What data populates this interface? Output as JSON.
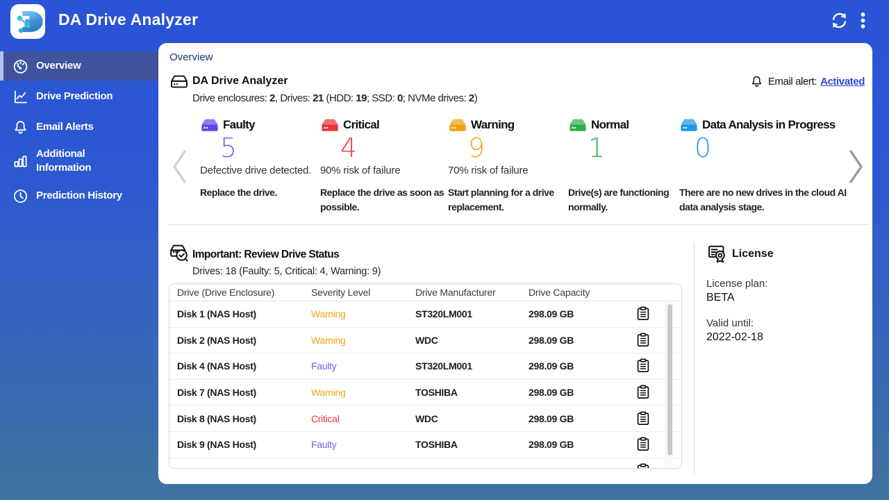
{
  "header": {
    "title": "DA Drive Analyzer",
    "actions": {
      "refresh_icon": "refresh",
      "menu_icon": "kebab-vertical"
    }
  },
  "sidebar": {
    "items": [
      {
        "label": "Overview",
        "icon": "gauge",
        "active": true
      },
      {
        "label": "Drive Prediction",
        "icon": "line-chart",
        "active": false
      },
      {
        "label": "Email Alerts",
        "icon": "bell",
        "active": false
      },
      {
        "label": "Additional Information",
        "icon": "bar-chart",
        "active": false
      },
      {
        "label": "Prediction History",
        "icon": "clock",
        "active": false
      }
    ],
    "active_bg": "#3e529e",
    "active_indicator": "#b3bfec"
  },
  "page": {
    "title": "Overview",
    "summary": {
      "title": "DA Drive Analyzer",
      "subtitle_segments": [
        {
          "t": "Drive enclosures: ",
          "c": ""
        },
        {
          "t": "2",
          "c": "b"
        },
        {
          "t": ", Drives: ",
          "c": ""
        },
        {
          "t": "21",
          "c": "b"
        },
        {
          "t": " (HDD: ",
          "c": ""
        },
        {
          "t": "19",
          "c": "b"
        },
        {
          "t": "; SSD: ",
          "c": ""
        },
        {
          "t": "0",
          "c": "b"
        },
        {
          "t": "; NVMe drives: ",
          "c": ""
        },
        {
          "t": "2",
          "c": "b"
        },
        {
          "t": ")",
          "c": ""
        }
      ],
      "email_alert_label": "Email alert:",
      "email_alert_value": "Activated",
      "link_color": "#2b49d8"
    },
    "statuses": [
      {
        "label": "Faulty",
        "count": "5",
        "color": "#7a5cf5",
        "icon_color": "#5b49ea",
        "subtitle": "Defective drive detected.",
        "description": "Replace the drive."
      },
      {
        "label": "Critical",
        "count": "4",
        "color": "#ea4547",
        "icon_color": "#e8323c",
        "subtitle": "90% risk of failure",
        "description": "Replace the drive as soon as possible."
      },
      {
        "label": "Warning",
        "count": "9",
        "color": "#f2ab1d",
        "icon_color": "#f09f10",
        "subtitle": "70% risk of failure",
        "description": "Start planning for a drive replacement."
      },
      {
        "label": "Normal",
        "count": "1",
        "color": "#2eb34a",
        "icon_color": "#2cae48",
        "subtitle": "",
        "description": "Drive(s) are functioning normally."
      },
      {
        "label": "Data Analysis in Progress",
        "count": "0",
        "color": "#2d9ce8",
        "icon_color": "#1e97e8",
        "subtitle": "",
        "description": "There are no new drives in the cloud AI data analysis stage."
      }
    ],
    "review": {
      "title": "Important: Review Drive Status",
      "subtitle": "Drives: 18 (Faulty: 5, Critical: 4, Warning: 9)",
      "table": {
        "columns": [
          "Drive (Drive Enclosure)",
          "Severity Level",
          "Drive Manufacturer",
          "Drive Capacity"
        ],
        "rows": [
          {
            "drive": "Disk 1 (NAS Host)",
            "severity": "Warning",
            "manufacturer": "ST320LM001",
            "capacity": "298.09 GB"
          },
          {
            "drive": "Disk 2 (NAS Host)",
            "severity": "Warning",
            "manufacturer": "WDC",
            "capacity": "298.09 GB"
          },
          {
            "drive": "Disk 4 (NAS Host)",
            "severity": "Faulty",
            "manufacturer": "ST320LM001",
            "capacity": "298.09 GB"
          },
          {
            "drive": "Disk 7 (NAS Host)",
            "severity": "Warning",
            "manufacturer": "TOSHIBA",
            "capacity": "298.09 GB"
          },
          {
            "drive": "Disk 8 (NAS Host)",
            "severity": "Critical",
            "manufacturer": "WDC",
            "capacity": "298.09 GB"
          },
          {
            "drive": "Disk 9 (NAS Host)",
            "severity": "Faulty",
            "manufacturer": "TOSHIBA",
            "capacity": "298.09 GB"
          },
          {
            "drive": "",
            "severity": "",
            "manufacturer": "",
            "capacity": ""
          }
        ],
        "severity_colors": {
          "warning": "#f0a312",
          "faulty": "#7a5cf5",
          "critical": "#e43b3c"
        }
      }
    },
    "license": {
      "title": "License",
      "plan_label": "License plan:",
      "plan_value": "BETA",
      "valid_label": "Valid until:",
      "valid_value": "2022-02-18"
    }
  }
}
